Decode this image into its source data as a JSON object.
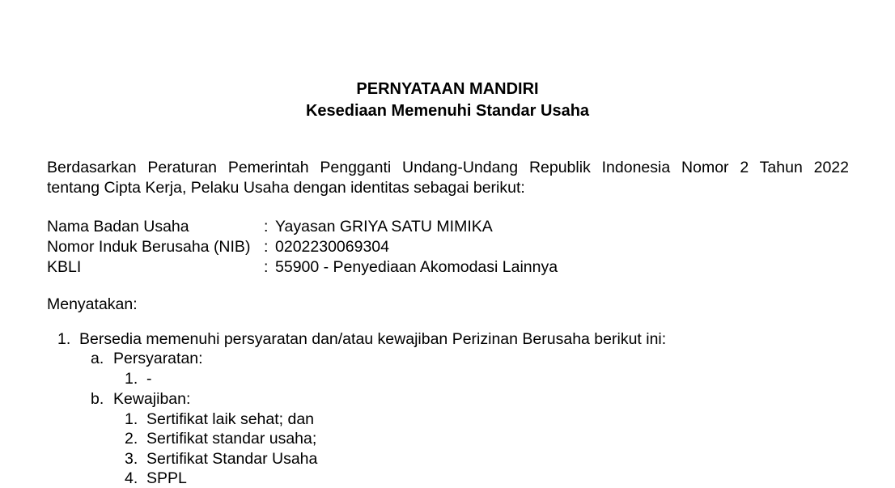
{
  "doc": {
    "title": "PERNYATAAN MANDIRI",
    "subtitle": "Kesediaan Memenuhi Standar Usaha",
    "intro_line1": "Berdasarkan Peraturan Pemerintah Pengganti Undang-Undang Republik Indonesia Nomor 2 Tahun 2022",
    "intro_line2": "tentang Cipta Kerja, Pelaku Usaha dengan identitas sebagai berikut:",
    "identity": [
      {
        "label": "Nama Badan Usaha",
        "colon": ":",
        "value": "Yayasan GRIYA SATU MIMIKA"
      },
      {
        "label": "Nomor Induk Berusaha (NIB)",
        "colon": ":",
        "value": "0202230069304"
      },
      {
        "label": "KBLI",
        "colon": ":",
        "value": "55900 - Penyediaan Akomodasi Lainnya"
      }
    ],
    "statement_label": "Menyatakan:",
    "items": [
      {
        "number": "1.",
        "text": "Bersedia memenuhi persyaratan dan/atau kewajiban Perizinan Berusaha berikut ini:",
        "sub": [
          {
            "letter": "a.",
            "text": "Persyaratan:",
            "entries": [
              {
                "number": "1.",
                "text": "-"
              }
            ]
          },
          {
            "letter": "b.",
            "text": "Kewajiban:",
            "entries": [
              {
                "number": "1.",
                "text": "Sertifikat laik sehat; dan"
              },
              {
                "number": "2.",
                "text": "Sertifikat standar usaha;"
              },
              {
                "number": "3.",
                "text": "Sertifikat Standar Usaha"
              },
              {
                "number": "4.",
                "text": "SPPL"
              }
            ]
          }
        ]
      }
    ]
  }
}
